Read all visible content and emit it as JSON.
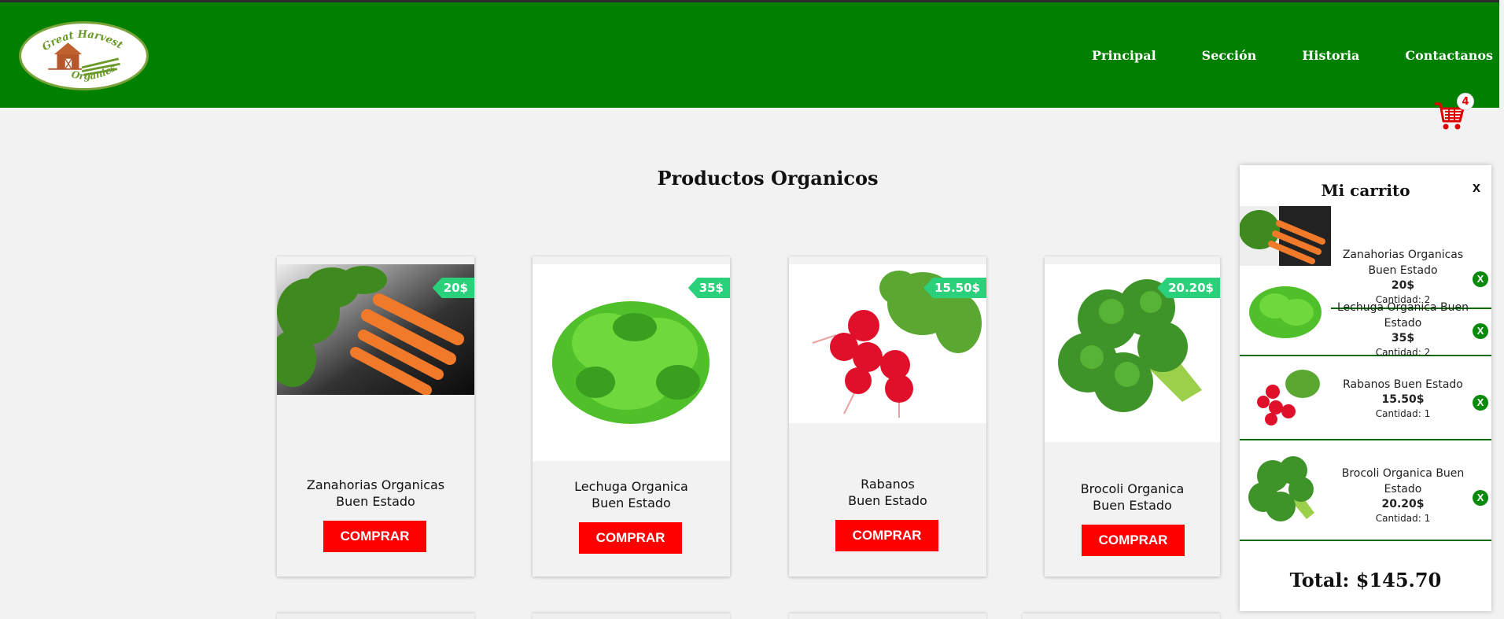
{
  "header": {
    "logo_line1": "Great Harvest",
    "logo_line2": "Organics",
    "nav": [
      "Principal",
      "Sección",
      "Historia",
      "Contactanos"
    ],
    "bg_color": "#008000"
  },
  "cart_button": {
    "icon": "shopping-cart-icon",
    "count": "4"
  },
  "main": {
    "title": "Productos Organicos"
  },
  "products": [
    {
      "name_line1": "Zanahorias Organicas",
      "name_line2": "Buen Estado",
      "price": "20$",
      "button": "COMPRAR"
    },
    {
      "name_line1": "Lechuga Organica",
      "name_line2": "Buen Estado",
      "price": "35$",
      "button": "COMPRAR"
    },
    {
      "name_line1": "Rabanos",
      "name_line2": "Buen Estado",
      "price": "15.50$",
      "button": "COMPRAR"
    },
    {
      "name_line1": "Brocoli Organica",
      "name_line2": "Buen Estado",
      "price": "20.20$",
      "button": "COMPRAR"
    }
  ],
  "cart": {
    "title": "Mi carrito",
    "close": "x",
    "items": [
      {
        "name": "Zanahorias Organicas Buen Estado",
        "price": "20$",
        "qty": "Cantidad: 2",
        "remove": "X"
      },
      {
        "name": "Lechuga Organica Buen Estado",
        "price": "35$",
        "qty": "Cantidad: 2",
        "remove": "X"
      },
      {
        "name": "Rabanos Buen Estado",
        "price": "15.50$",
        "qty": "Cantidad: 1",
        "remove": "X"
      },
      {
        "name": "Brocoli Organica Buen Estado",
        "price": "20.20$",
        "qty": "Cantidad: 1",
        "remove": "X"
      }
    ],
    "total": "Total: $145.70"
  },
  "colors": {
    "accent_green": "#008000",
    "price_tag": "#2bd07a",
    "buy_button": "#ff0000"
  }
}
